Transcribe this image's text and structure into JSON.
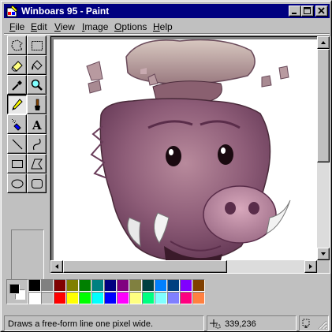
{
  "window": {
    "title": "Winboars 95 - Paint"
  },
  "menu": [
    {
      "label": "File",
      "mnemonic": "F",
      "rest": "ile"
    },
    {
      "label": "Edit",
      "mnemonic": "E",
      "rest": "dit"
    },
    {
      "label": "View",
      "mnemonic": "V",
      "rest": "iew"
    },
    {
      "label": "Image",
      "mnemonic": "I",
      "rest": "mage"
    },
    {
      "label": "Options",
      "mnemonic": "O",
      "rest": "ptions"
    },
    {
      "label": "Help",
      "mnemonic": "H",
      "rest": "elp"
    }
  ],
  "tools": [
    {
      "name": "free-form-select",
      "icon": "free-select-icon"
    },
    {
      "name": "rectangle-select",
      "icon": "rect-select-icon"
    },
    {
      "name": "eraser",
      "icon": "eraser-icon"
    },
    {
      "name": "fill-with-color",
      "icon": "paint-bucket-icon"
    },
    {
      "name": "pick-color",
      "icon": "eyedropper-icon"
    },
    {
      "name": "magnifier",
      "icon": "magnifier-icon"
    },
    {
      "name": "pencil",
      "icon": "pencil-icon",
      "active": true
    },
    {
      "name": "brush",
      "icon": "brush-icon"
    },
    {
      "name": "airbrush",
      "icon": "airbrush-icon"
    },
    {
      "name": "text",
      "icon": "text-icon",
      "glyph": "A"
    },
    {
      "name": "line",
      "icon": "line-icon"
    },
    {
      "name": "curve",
      "icon": "curve-icon"
    },
    {
      "name": "rectangle",
      "icon": "rectangle-icon"
    },
    {
      "name": "polygon",
      "icon": "polygon-icon"
    },
    {
      "name": "ellipse",
      "icon": "ellipse-icon"
    },
    {
      "name": "rounded-rectangle",
      "icon": "rounded-rect-icon"
    }
  ],
  "colors": {
    "foreground": "#000000",
    "background": "#ffffff",
    "palette_top": [
      "#000000",
      "#808080",
      "#800000",
      "#808000",
      "#008000",
      "#008080",
      "#000080",
      "#800080",
      "#808040",
      "#004040",
      "#0080ff",
      "#004080",
      "#8000ff",
      "#804000"
    ],
    "palette_bottom": [
      "#ffffff",
      "#c0c0c0",
      "#ff0000",
      "#ffff00",
      "#00ff00",
      "#00ffff",
      "#0000ff",
      "#ff00ff",
      "#ffff80",
      "#00ff80",
      "#80ffff",
      "#8080ff",
      "#ff0080",
      "#ff8040"
    ]
  },
  "status": {
    "help_text": "Draws a free-form line one pixel wide.",
    "coordinates": "339,236"
  }
}
